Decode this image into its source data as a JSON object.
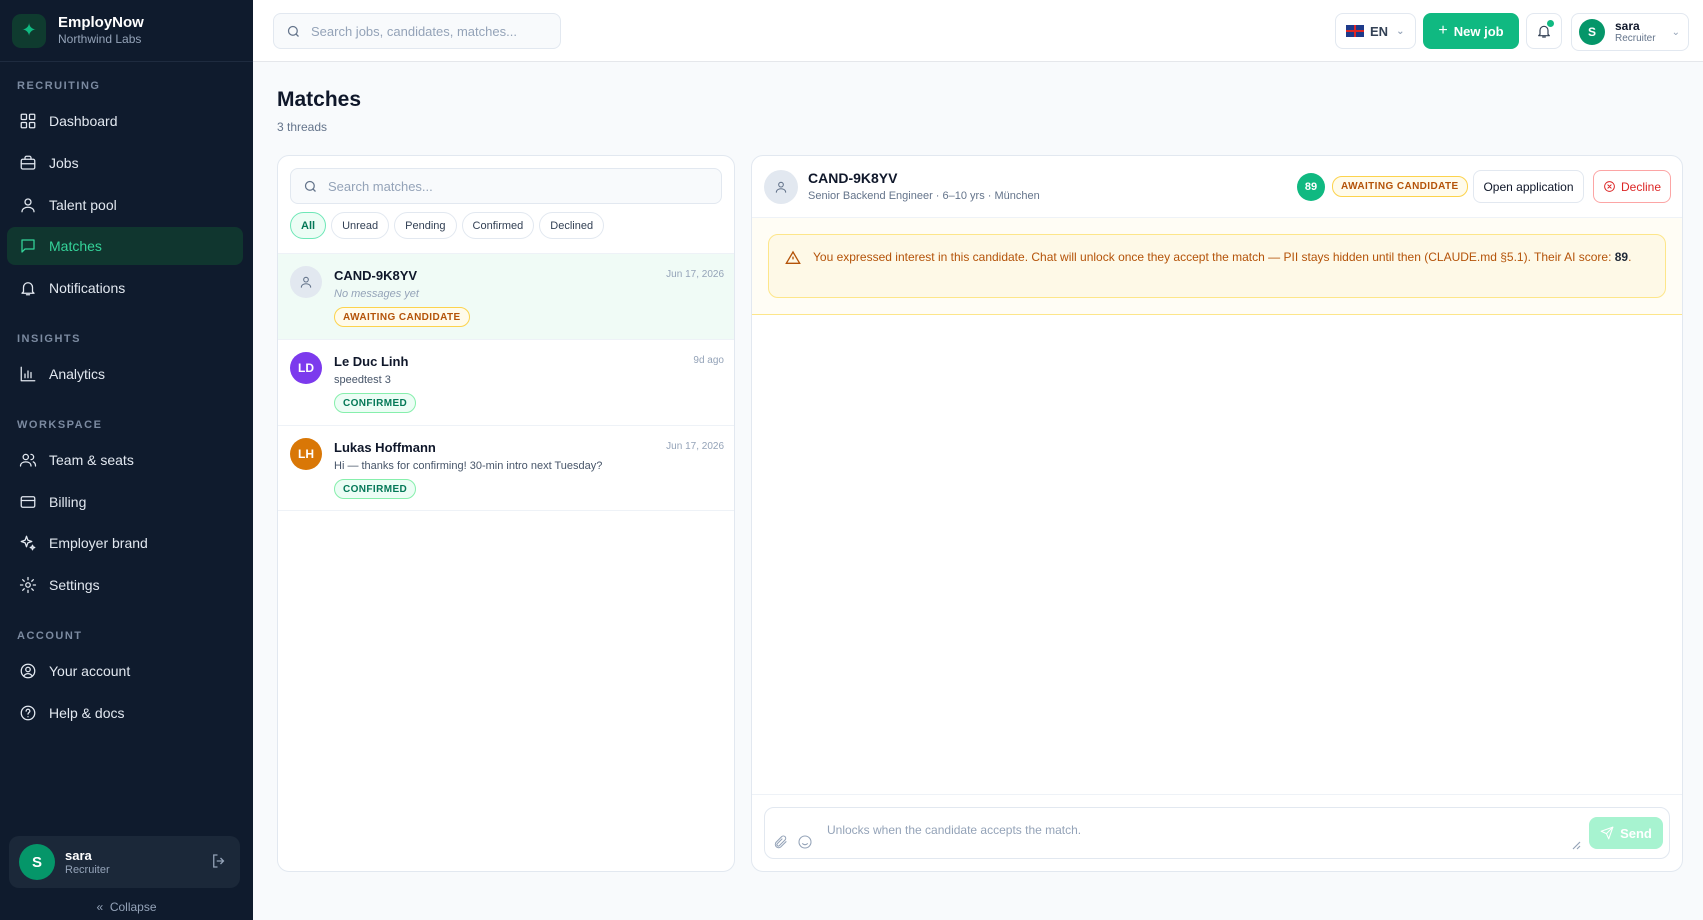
{
  "app": {
    "name": "EmployNow",
    "org": "Northwind Labs",
    "logo_icon": "sparkle-icon"
  },
  "sidebar": {
    "sections": [
      {
        "label": "RECRUITING",
        "items": [
          {
            "label": "Dashboard",
            "icon": "grid-icon"
          },
          {
            "label": "Jobs",
            "icon": "briefcase-icon"
          },
          {
            "label": "Talent pool",
            "icon": "user-icon"
          },
          {
            "label": "Matches",
            "icon": "chat-icon",
            "active": true
          },
          {
            "label": "Notifications",
            "icon": "bell-icon"
          }
        ]
      },
      {
        "label": "INSIGHTS",
        "items": [
          {
            "label": "Analytics",
            "icon": "bar-chart-icon"
          }
        ]
      },
      {
        "label": "WORKSPACE",
        "items": [
          {
            "label": "Team & seats",
            "icon": "users-icon"
          },
          {
            "label": "Billing",
            "icon": "credit-card-icon"
          },
          {
            "label": "Employer brand",
            "icon": "sparkles-icon"
          },
          {
            "label": "Settings",
            "icon": "gear-icon"
          }
        ]
      },
      {
        "label": "ACCOUNT",
        "items": [
          {
            "label": "Your account",
            "icon": "user-circle-icon"
          },
          {
            "label": "Help & docs",
            "icon": "help-icon"
          }
        ]
      }
    ],
    "user": {
      "initial": "S",
      "name": "sara",
      "role": "Recruiter"
    },
    "collapse_label": "Collapse"
  },
  "topbar": {
    "search_placeholder": "Search jobs, candidates, matches...",
    "language": "EN",
    "new_job_label": "New job",
    "user": {
      "initial": "S",
      "name": "sara",
      "role": "Recruiter"
    }
  },
  "page": {
    "title": "Matches",
    "subtitle": "3 threads"
  },
  "list": {
    "search_placeholder": "Search matches...",
    "filters": [
      "All",
      "Unread",
      "Pending",
      "Confirmed",
      "Declined"
    ],
    "active_filter": "All",
    "threads": [
      {
        "name": "CAND-9K8YV",
        "initials": "",
        "avatar_color": "#e2e8f0",
        "date": "Jun 17, 2026",
        "message": "No messages yet",
        "status": "AWAITING CANDIDATE",
        "status_kind": "awaiting",
        "selected": true
      },
      {
        "name": "Le Duc Linh",
        "initials": "LD",
        "avatar_color": "#7c3aed",
        "date": "9d ago",
        "message": "speedtest 3",
        "status": "CONFIRMED",
        "status_kind": "confirmed",
        "selected": false
      },
      {
        "name": "Lukas Hoffmann",
        "initials": "LH",
        "avatar_color": "#d97706",
        "date": "Jun 17, 2026",
        "message": "Hi — thanks for confirming! 30-min intro next Tuesday?",
        "status": "CONFIRMED",
        "status_kind": "confirmed",
        "selected": false
      }
    ]
  },
  "chat": {
    "candidate_id": "CAND-9K8YV",
    "details": "Senior Backend Engineer · 6–10 yrs · München",
    "score": "89",
    "status": "AWAITING CANDIDATE",
    "open_application_label": "Open application",
    "decline_label": "Decline",
    "notice_text": "You expressed interest in this candidate. Chat will unlock once they accept the match — PII stays hidden until then (CLAUDE.md §5.1).  Their AI score: ",
    "notice_score": "89",
    "composer_placeholder": "Unlocks when the candidate accepts the match.",
    "send_label": "Send"
  }
}
